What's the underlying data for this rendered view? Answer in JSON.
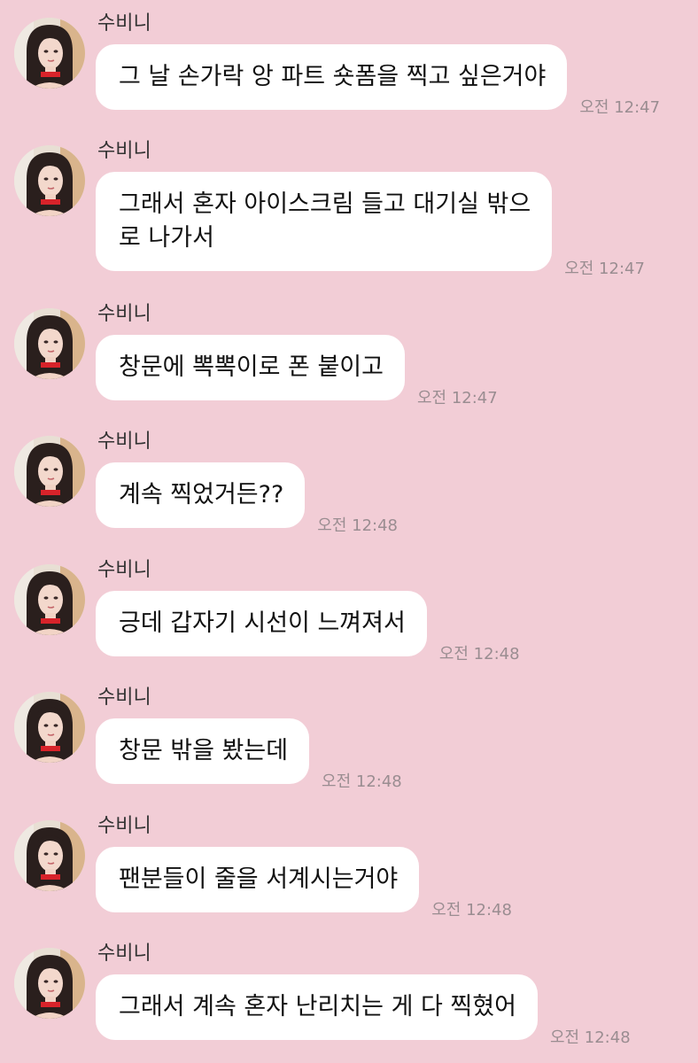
{
  "colors": {
    "background": "#f2cdd6",
    "bubble": "#ffffff",
    "timestamp": "#9a8d91",
    "name": "#333333"
  },
  "messages": [
    {
      "sender": "수비니",
      "text": "그 날 손가락 앙 파트 숏폼을 찍고 싶은거야",
      "time": "오전 12:47"
    },
    {
      "sender": "수비니",
      "text": "그래서 혼자 아이스크림 들고 대기실 밖으\n로 나가서",
      "time": "오전 12:47"
    },
    {
      "sender": "수비니",
      "text": "창문에 뽁뽁이로 폰 붙이고",
      "time": "오전 12:47"
    },
    {
      "sender": "수비니",
      "text": "계속 찍었거든??",
      "time": "오전 12:48"
    },
    {
      "sender": "수비니",
      "text": "긍데 갑자기 시선이 느껴져서",
      "time": "오전 12:48"
    },
    {
      "sender": "수비니",
      "text": "창문 밖을 봤는데",
      "time": "오전 12:48"
    },
    {
      "sender": "수비니",
      "text": "팬분들이 줄을 서계시는거야",
      "time": "오전 12:48"
    },
    {
      "sender": "수비니",
      "text": "그래서 계속 혼자 난리치는 게 다 찍혔어",
      "time": "오전 12:48"
    }
  ]
}
